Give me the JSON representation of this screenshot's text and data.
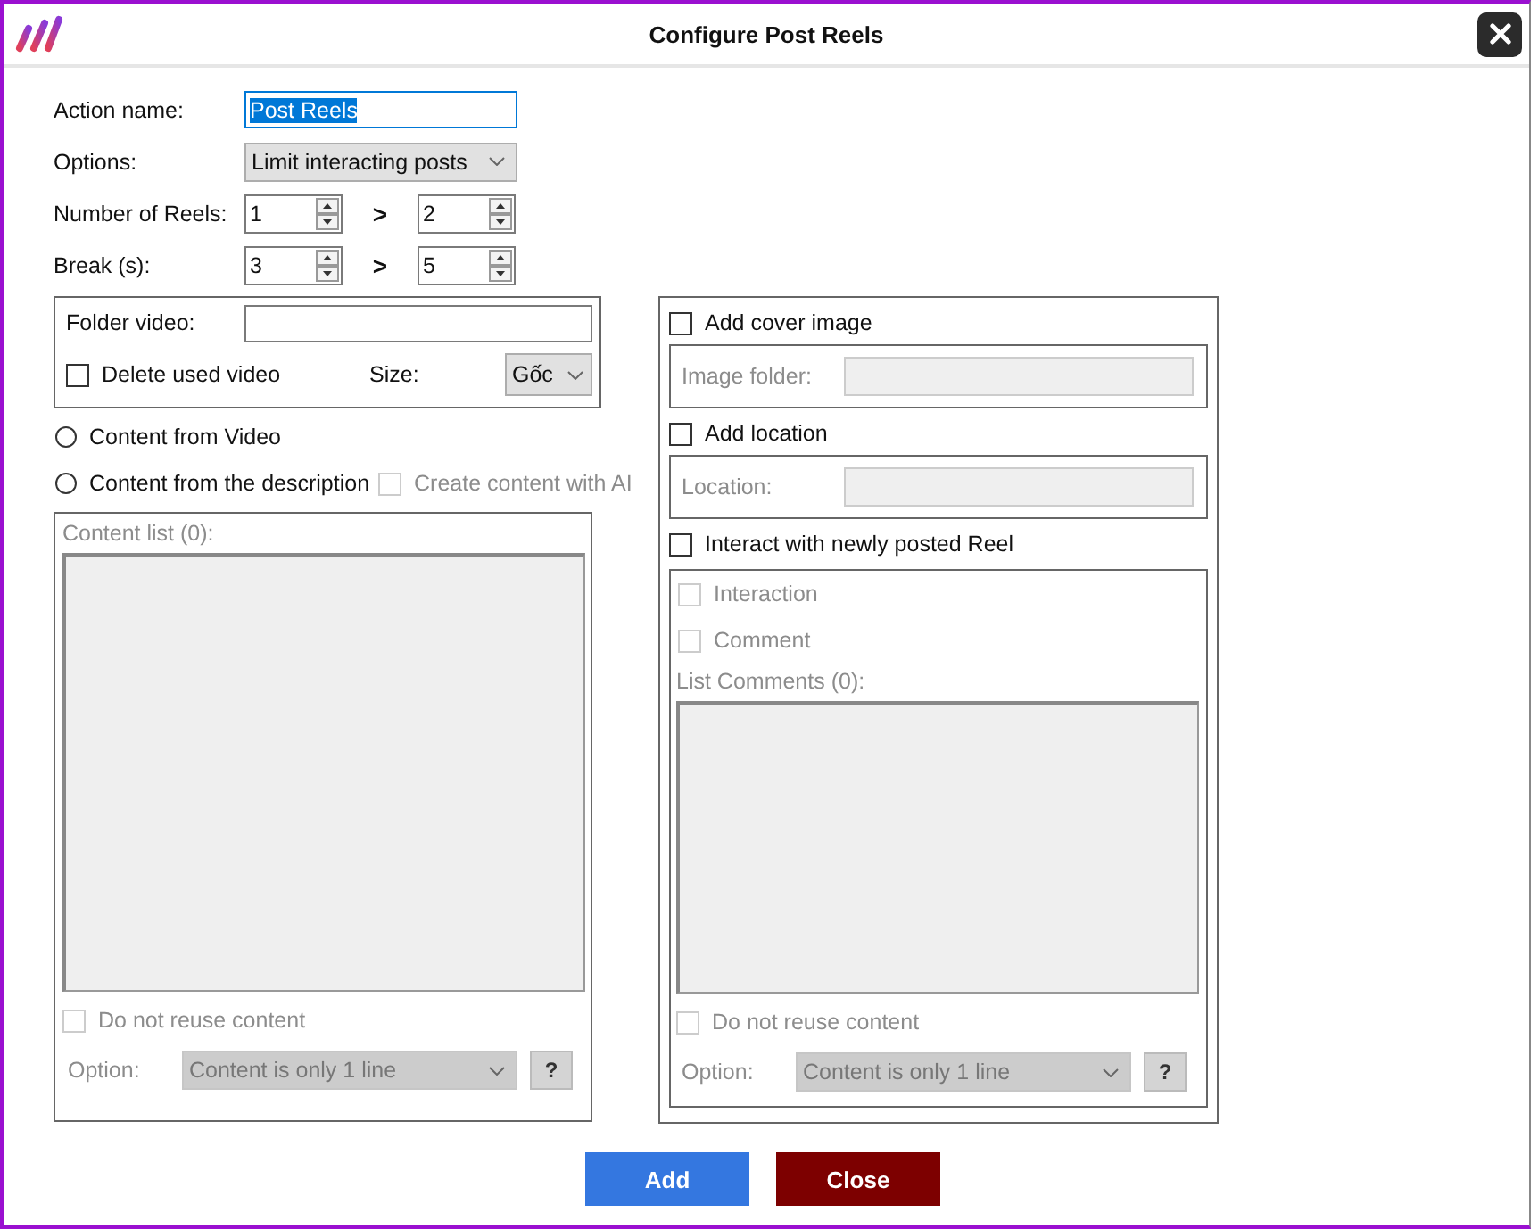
{
  "window": {
    "title": "Configure Post Reels"
  },
  "form": {
    "action_name": {
      "label": "Action name:",
      "value": "Post Reels",
      "selected": true
    },
    "options": {
      "label": "Options:",
      "value": "Limit interacting posts"
    },
    "ranges": [
      {
        "label": "Number of Reels:",
        "from": "1",
        "separator": ">",
        "to": "2"
      },
      {
        "label": "Break (s):",
        "from": "3",
        "separator": ">",
        "to": "5"
      }
    ]
  },
  "video": {
    "folder_label": "Folder video:",
    "delete_used_video": {
      "label": "Delete used video",
      "checked": false
    },
    "size_label": "Size:",
    "size": "Gốc"
  },
  "content_source": [
    {
      "label": "Content from Video",
      "selected": false
    },
    {
      "label": "Content from the description",
      "selected": false
    }
  ],
  "ai_option": {
    "label": "Create content with AI",
    "checked": false,
    "disabled": true
  },
  "content_list": {
    "label": "Content list (0):",
    "no_reuse": {
      "label": "Do not reuse content",
      "checked": false,
      "disabled": true
    },
    "option_label": "Option:",
    "option": "Content is only 1 line",
    "help": "?"
  },
  "cover_image": {
    "label": "Add cover image",
    "checked": false,
    "field_label": "Image folder:"
  },
  "location": {
    "label": "Add location",
    "checked": false,
    "field_label": "Location:"
  },
  "interact": {
    "label": "Interact with newly posted Reel",
    "checked": false,
    "items": [
      {
        "label": "Interaction",
        "checked": false,
        "disabled": true
      },
      {
        "label": "Comment",
        "checked": false,
        "disabled": true
      }
    ],
    "list_label": "List Comments (0):",
    "no_reuse": {
      "label": "Do not reuse content",
      "checked": false,
      "disabled": true
    },
    "option_label": "Option:",
    "option": "Content is only 1 line",
    "help": "?"
  },
  "buttons": [
    {
      "label": "Add",
      "kind": "primary"
    },
    {
      "label": "Close",
      "kind": "danger"
    }
  ]
}
